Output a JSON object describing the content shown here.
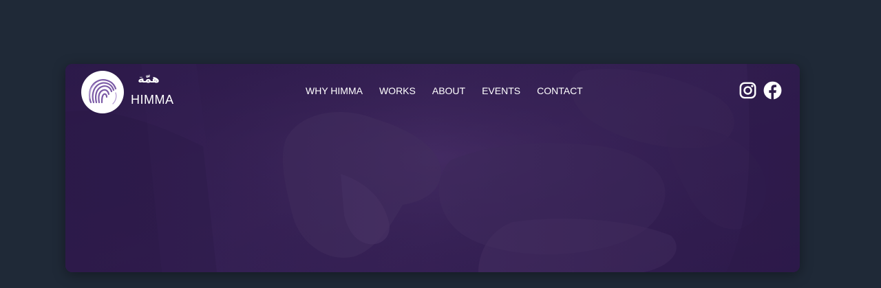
{
  "brand": {
    "arabic_name": "همّة",
    "name": "HIMMA"
  },
  "nav": {
    "items": [
      {
        "label": "WHY HIMMA"
      },
      {
        "label": "WORKS"
      },
      {
        "label": "ABOUT"
      },
      {
        "label": "EVENTS"
      },
      {
        "label": "CONTACT"
      }
    ]
  },
  "social": {
    "icons": [
      "instagram-icon",
      "facebook-icon"
    ]
  },
  "colors": {
    "page_background": "#1f2937",
    "hero_overlay": "#2f1d4a",
    "text": "#ffffff",
    "logo_accent": "#7b5aa6"
  }
}
